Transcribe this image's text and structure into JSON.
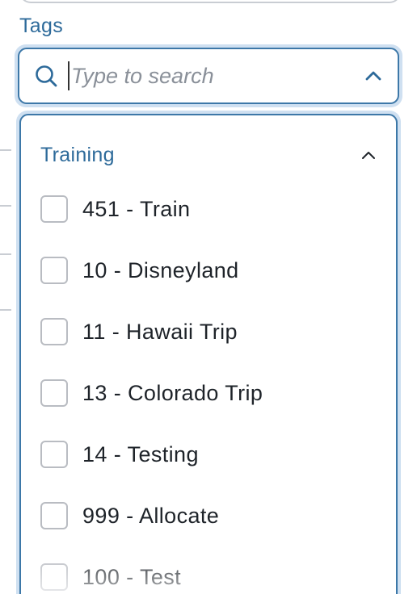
{
  "field": {
    "label": "Tags"
  },
  "search": {
    "placeholder": "Type to search",
    "value": ""
  },
  "group": {
    "title": "Training",
    "expanded": true
  },
  "options": [
    {
      "label": "451 - Train",
      "checked": false
    },
    {
      "label": "10 - Disneyland",
      "checked": false
    },
    {
      "label": "11 - Hawaii Trip",
      "checked": false
    },
    {
      "label": "13 - Colorado Trip",
      "checked": false
    },
    {
      "label": "14 - Testing",
      "checked": false
    },
    {
      "label": "999 - Allocate",
      "checked": false
    },
    {
      "label": "100 - Test",
      "checked": false
    }
  ],
  "colors": {
    "accent": "#2d6a9a",
    "border": "#3d78a8",
    "focus_ring": "#cfe0f1",
    "checkbox_border": "#b9bcc2"
  },
  "icons": {
    "search": "search-icon",
    "collapse": "chevron-up-icon",
    "group_collapse": "chevron-up-icon"
  }
}
